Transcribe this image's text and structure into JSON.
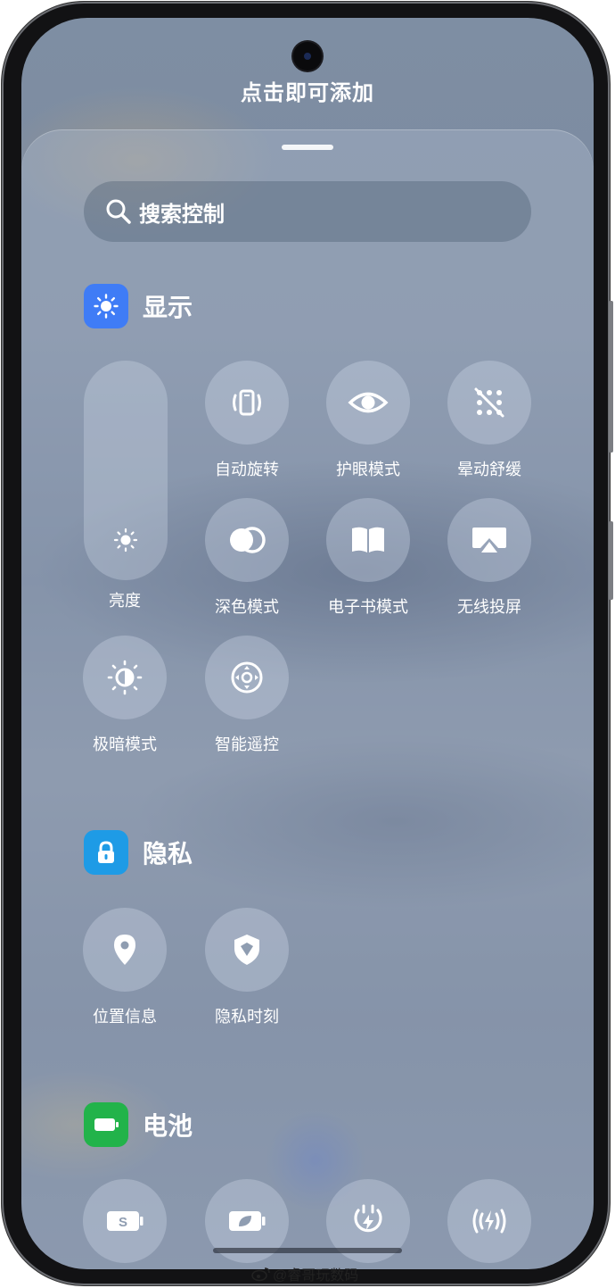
{
  "header": {
    "add_hint": "点击即可添加"
  },
  "search": {
    "label": "搜索控制",
    "icon": "search-icon"
  },
  "sections": {
    "display": {
      "title": "显示",
      "badge_color": "#3f7cf6",
      "brightness_label": "亮度",
      "tiles": [
        {
          "label": "自动旋转",
          "icon": "auto-rotate-icon"
        },
        {
          "label": "护眼模式",
          "icon": "eye-icon"
        },
        {
          "label": "晕动舒缓",
          "icon": "motion-comfort-icon"
        },
        {
          "label": "深色模式",
          "icon": "dark-mode-icon"
        },
        {
          "label": "电子书模式",
          "icon": "book-icon"
        },
        {
          "label": "无线投屏",
          "icon": "screen-cast-icon"
        },
        {
          "label": "极暗模式",
          "icon": "extra-dim-icon"
        },
        {
          "label": "智能遥控",
          "icon": "remote-control-icon"
        }
      ]
    },
    "privacy": {
      "title": "隐私",
      "badge_color": "#1e9be6",
      "tiles": [
        {
          "label": "位置信息",
          "icon": "location-pin-icon"
        },
        {
          "label": "隐私时刻",
          "icon": "privacy-shield-icon"
        }
      ]
    },
    "battery": {
      "title": "电池",
      "badge_color": "#22b34a",
      "tiles": [
        {
          "icon": "battery-saver-icon"
        },
        {
          "icon": "eco-battery-icon"
        },
        {
          "icon": "charging-plug-icon"
        },
        {
          "icon": "wireless-charge-icon"
        }
      ]
    }
  },
  "watermark": {
    "text": "@睿哥玩数码",
    "icon": "weibo-icon"
  }
}
